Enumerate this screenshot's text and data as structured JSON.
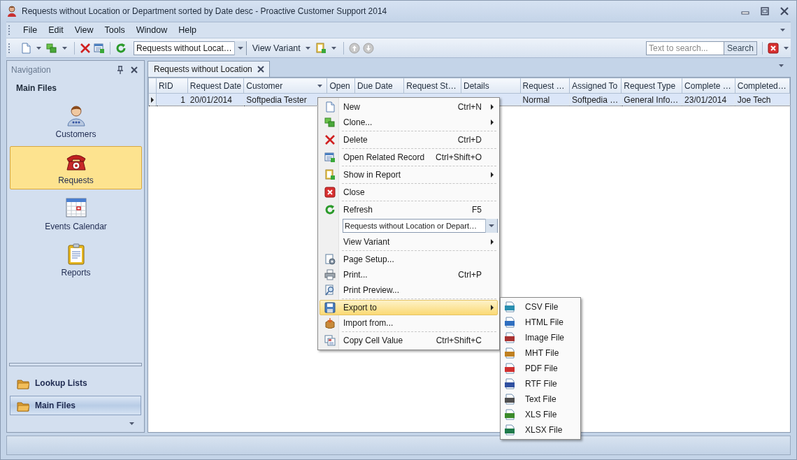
{
  "window": {
    "title": "Requests without Location or Department sorted by Date desc - Proactive Customer Support 2014"
  },
  "menu_bar": [
    "File",
    "Edit",
    "View",
    "Tools",
    "Window",
    "Help"
  ],
  "toolbar": {
    "variant_combo": "Requests without Locat…",
    "view_variant": "View Variant",
    "search": {
      "placeholder": "Text to search..."
    },
    "search_button": "Search"
  },
  "navigation": {
    "title": "Navigation",
    "heading": "Main Files",
    "items": [
      {
        "label": "Customers",
        "selected": false
      },
      {
        "label": "Requests",
        "selected": true
      },
      {
        "label": "Events Calendar",
        "selected": false
      },
      {
        "label": "Reports",
        "selected": false
      }
    ],
    "groups": [
      {
        "label": "Lookup Lists",
        "selected": false
      },
      {
        "label": "Main Files",
        "selected": true
      }
    ]
  },
  "document_tab": {
    "label": "Requests without Location",
    "selected": true
  },
  "table": {
    "columns": [
      "RID",
      "Request Date",
      "Customer",
      "Open",
      "Due Date",
      "Request St…",
      "Details",
      "Request …",
      "Assigned To",
      "Request Type",
      "Complete …",
      "Completed…"
    ],
    "rows": [
      {
        "selected": true,
        "cells": [
          "1",
          "20/01/2014",
          "Softpedia Tester",
          null,
          null,
          null,
          null,
          "Normal",
          "Softpedia …",
          "General Info…",
          "23/01/2014",
          "Joe Tech"
        ]
      }
    ]
  },
  "context_menu": {
    "groups": [
      [
        {
          "kind": "item",
          "label": "New",
          "shortcut": "Ctrl+N",
          "submenu": true,
          "selected": false
        },
        {
          "kind": "item",
          "label": "Clone...",
          "submenu": true,
          "selected": false
        }
      ],
      [
        {
          "kind": "item",
          "label": "Delete",
          "shortcut": "Ctrl+D",
          "submenu": false,
          "selected": false
        }
      ],
      [
        {
          "kind": "item",
          "label": "Open Related Record",
          "shortcut": "Ctrl+Shift+O",
          "submenu": false,
          "selected": false
        }
      ],
      [
        {
          "kind": "item",
          "label": "Show in Report",
          "submenu": true,
          "selected": false
        }
      ],
      [
        {
          "kind": "item",
          "label": "Close",
          "submenu": false,
          "selected": false
        }
      ],
      [
        {
          "kind": "item",
          "label": "Refresh",
          "shortcut": "F5",
          "submenu": false,
          "selected": false
        },
        {
          "kind": "combo",
          "value": "Requests without Location or Depart…"
        },
        {
          "kind": "item",
          "label": "View Variant",
          "submenu": true,
          "selected": false
        }
      ],
      [
        {
          "kind": "item",
          "label": "Page Setup...",
          "submenu": false,
          "selected": false
        },
        {
          "kind": "item",
          "label": "Print...",
          "shortcut": "Ctrl+P",
          "submenu": false,
          "selected": false
        },
        {
          "kind": "item",
          "label": "Print Preview...",
          "submenu": false,
          "selected": false
        }
      ],
      [
        {
          "kind": "item",
          "label": "Export to",
          "submenu": true,
          "selected": true
        },
        {
          "kind": "item",
          "label": "Import from...",
          "submenu": false,
          "selected": false
        }
      ],
      [
        {
          "kind": "item",
          "label": "Copy Cell Value",
          "shortcut": "Ctrl+Shift+C",
          "submenu": false,
          "selected": false
        }
      ]
    ]
  },
  "export_menu": [
    {
      "label": "CSV File",
      "color": "#2a8fb0"
    },
    {
      "label": "HTML File",
      "color": "#2f6fc0"
    },
    {
      "label": "Image File",
      "color": "#a83232"
    },
    {
      "label": "MHT File",
      "color": "#c08020"
    },
    {
      "label": "PDF File",
      "color": "#d03030"
    },
    {
      "label": "RTF File",
      "color": "#2f50a0"
    },
    {
      "label": "Text File",
      "color": "#505050"
    },
    {
      "label": "XLS File",
      "color": "#3a8a2a"
    },
    {
      "label": "XLSX File",
      "color": "#1f7a4a"
    }
  ]
}
